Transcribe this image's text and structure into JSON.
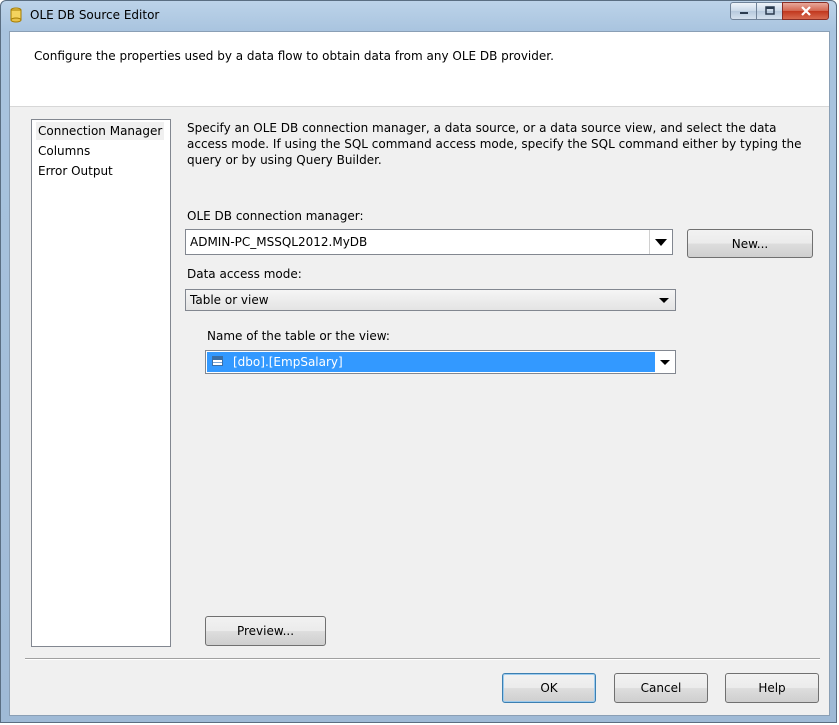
{
  "window": {
    "title": "OLE DB Source Editor",
    "icon": "ssis-source-icon"
  },
  "header": {
    "description": "Configure the properties used by a data flow to obtain data from any OLE DB provider."
  },
  "nav": {
    "items": [
      {
        "label": "Connection Manager",
        "selected": true
      },
      {
        "label": "Columns",
        "selected": false
      },
      {
        "label": "Error Output",
        "selected": false
      }
    ]
  },
  "main": {
    "instructions": "Specify an OLE DB connection manager, a data source, or a data source view, and select the data access mode. If using the SQL command access mode, specify the SQL command either by typing the query or by using Query Builder.",
    "connection_label": "OLE DB connection manager:",
    "connection_value": "ADMIN-PC_MSSQL2012.MyDB",
    "new_button": "New...",
    "access_mode_label": "Data access mode:",
    "access_mode_value": "Table or view",
    "table_label": "Name of the table or the view:",
    "table_value": "[dbo].[EmpSalary]",
    "preview_button": "Preview..."
  },
  "footer": {
    "ok": "OK",
    "cancel": "Cancel",
    "help": "Help"
  },
  "colors": {
    "selection": "#3399ff",
    "client_bg": "#f0f0f0"
  }
}
